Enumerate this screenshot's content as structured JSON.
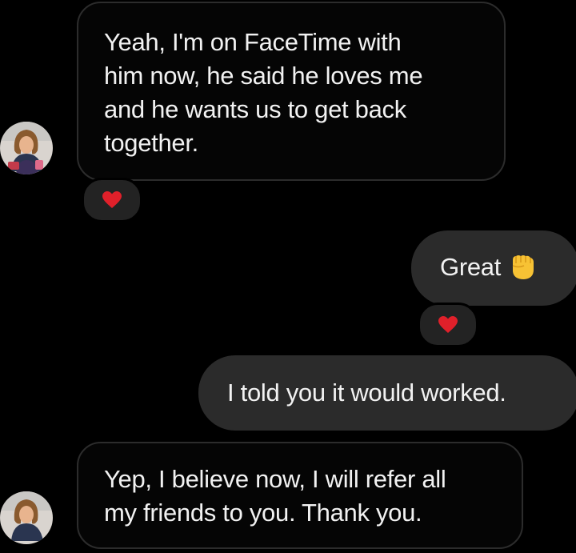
{
  "conversation": {
    "messages": [
      {
        "sender": "them",
        "text": "Yeah, I'm on FaceTime with\nhim now, he said he loves me\nand he wants us to get back\ntogether.",
        "reaction_icon": "red-heart-icon"
      },
      {
        "sender": "me",
        "text": "Great",
        "emoji_icon": "raised-fist-emoji-icon",
        "reaction_icon": "red-heart-icon"
      },
      {
        "sender": "me",
        "text": "I told you it would worked."
      },
      {
        "sender": "them",
        "text": "Yep, I believe now, I will refer all\nmy friends to you. Thank you."
      }
    ]
  },
  "colors": {
    "background": "#000000",
    "incoming_bubble_border": "#2c2c2c",
    "outgoing_bubble": "#2b2b2b",
    "reaction_pill": "#232323",
    "heart": "#e0202a",
    "fist_emoji": "#f7c234",
    "text": "#f2f2f2"
  }
}
